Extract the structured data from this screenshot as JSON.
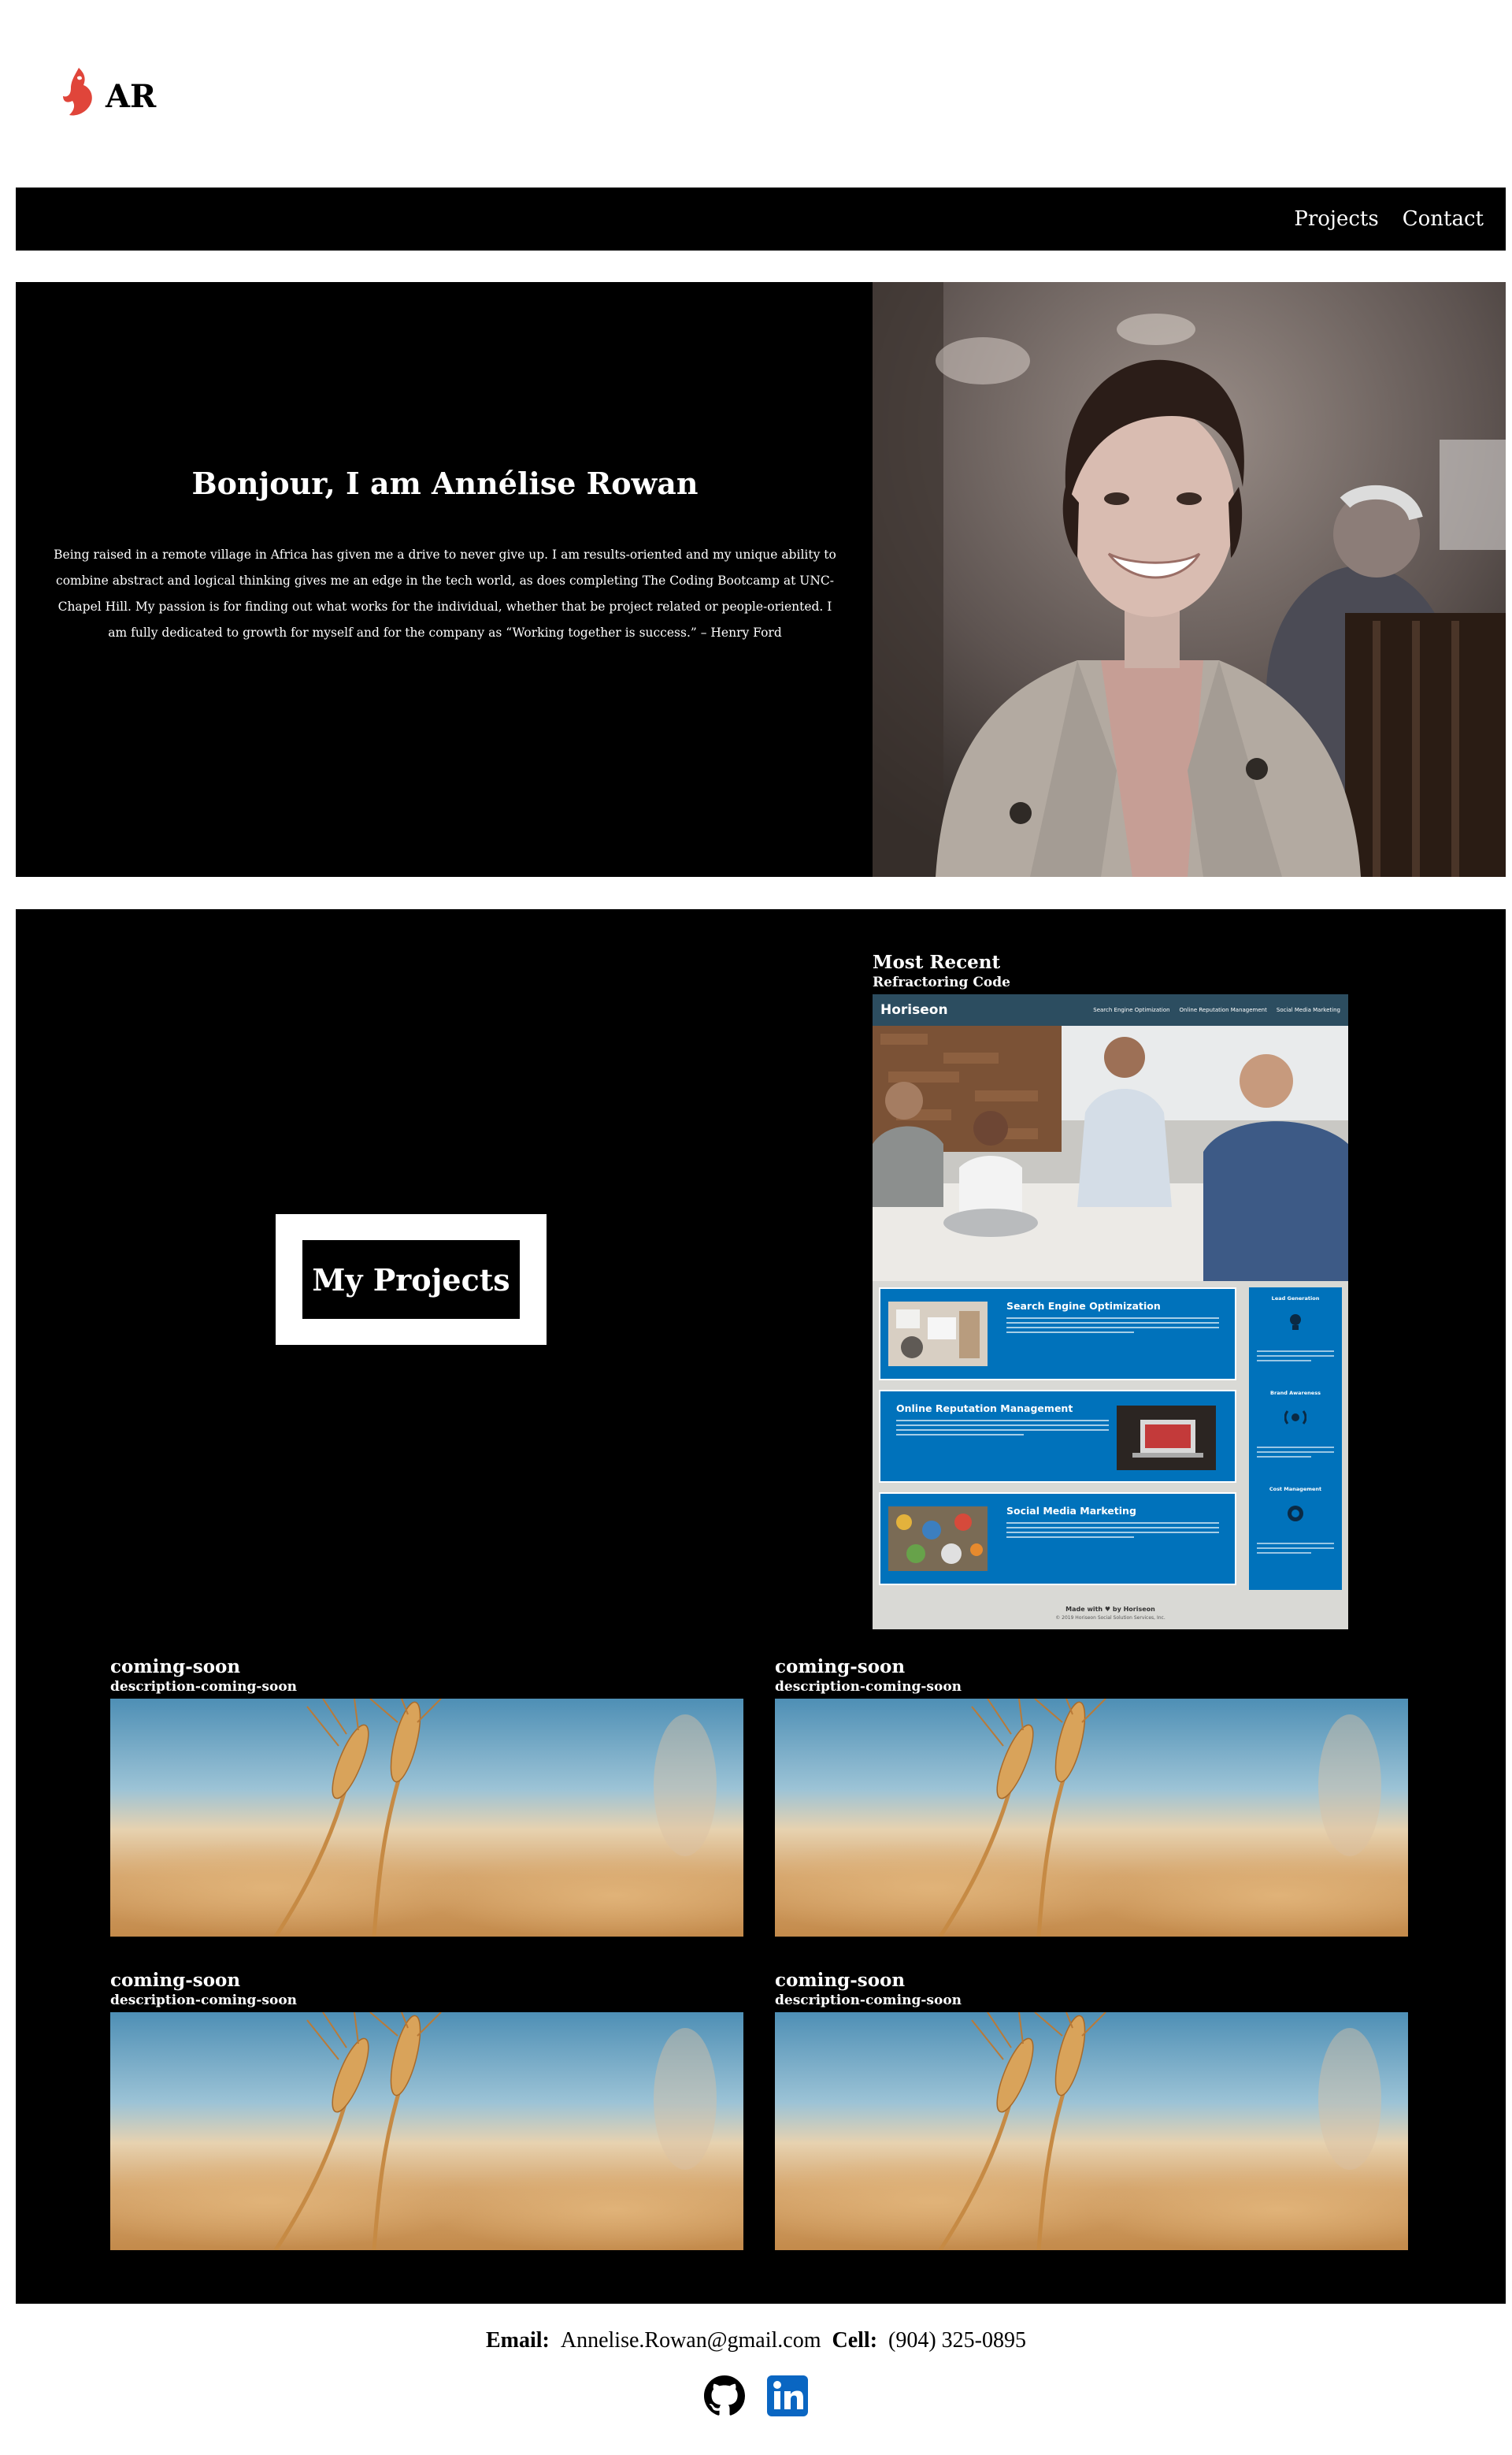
{
  "header": {
    "logo_text": "AR",
    "nav": [
      {
        "label": "Projects"
      },
      {
        "label": "Contact"
      }
    ]
  },
  "hero": {
    "title": "Bonjour, I am Annélise Rowan",
    "bio": "Being raised in a remote village in Africa has given me a drive to never give up. I am results-oriented and my unique ability to combine abstract and logical thinking gives me an edge in the tech world, as does completing The Coding Bootcamp at UNC- Chapel Hill. My passion is for finding out what works for the individual, whether that be project related or people-oriented. I am fully dedicated to growth for myself and for the company as “Working together is success.” – Henry Ford"
  },
  "projects": {
    "section_title": "My Projects",
    "recent": {
      "title": "Most Recent",
      "description": "Refractoring Code",
      "screenshot": {
        "brand": "Horiseon",
        "nav": [
          "Search Engine Optimization",
          "Online Reputation Management",
          "Social Media Marketing"
        ],
        "blocks": [
          "Search Engine Optimization",
          "Online Reputation Management",
          "Social Media Marketing"
        ],
        "sidebar": [
          "Lead Generation",
          "Brand Awareness",
          "Cost Management"
        ],
        "footer_made": "Made with ♥ by Horiseon",
        "footer_copy": "© 2019 Horiseon Social Solution Services, Inc."
      }
    },
    "coming_soon": [
      {
        "title": "coming-soon",
        "description": "description-coming-soon"
      },
      {
        "title": "coming-soon",
        "description": "description-coming-soon"
      },
      {
        "title": "coming-soon",
        "description": "description-coming-soon"
      },
      {
        "title": "coming-soon",
        "description": "description-coming-soon"
      }
    ]
  },
  "contact": {
    "email_label": "Email:",
    "email": "Annelise.Rowan@gmail.com",
    "cell_label": "Cell:",
    "cell": "(904) 325-0895"
  },
  "socials": [
    {
      "icon": "github-icon"
    },
    {
      "icon": "linkedin-icon"
    }
  ],
  "colors": {
    "background": "#ffffff",
    "section": "#000000",
    "horiseon_header": "#2c4d60",
    "horiseon_blue": "#0072bb",
    "logo_red": "#e0453a",
    "linkedin_blue": "#0a66c2"
  }
}
